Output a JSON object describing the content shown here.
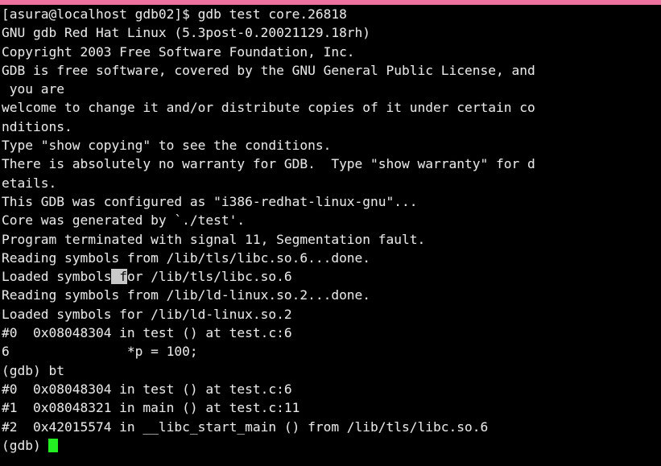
{
  "window": {
    "title_bar_color": "#ec719e",
    "background_color": "#000000",
    "foreground_color": "#e6e6e6",
    "cursor_color": "#22ee22",
    "selection_color": "#c9c9c9"
  },
  "terminal": {
    "prompt_user_host": "[asura@localhost gdb02]$",
    "command": "gdb test core.26818",
    "gdb_prompt": "(gdb)",
    "lines": [
      "[asura@localhost gdb02]$ gdb test core.26818",
      "GNU gdb Red Hat Linux (5.3post-0.20021129.18rh)",
      "Copyright 2003 Free Software Foundation, Inc.",
      "GDB is free software, covered by the GNU General Public License, and",
      " you are",
      "welcome to change it and/or distribute copies of it under certain co",
      "nditions.",
      "Type \"show copying\" to see the conditions.",
      "There is absolutely no warranty for GDB.  Type \"show warranty\" for d",
      "etails.",
      "This GDB was configured as \"i386-redhat-linux-gnu\"...",
      "Core was generated by `./test'.",
      "Program terminated with signal 11, Segmentation fault.",
      "Reading symbols from /lib/tls/libc.so.6...done.",
      "Loaded symbols for /lib/tls/libc.so.6",
      "Reading symbols from /lib/ld-linux.so.2...done.",
      "Loaded symbols for /lib/ld-linux.so.2",
      "#0  0x08048304 in test () at test.c:6",
      "6               *p = 100;",
      "(gdb) bt",
      "#0  0x08048304 in test () at test.c:6",
      "#1  0x08048321 in main () at test.c:11",
      "#2  0x42015574 in __libc_start_main () from /lib/tls/libc.so.6",
      "(gdb) "
    ],
    "highlighted_line_index": 14,
    "highlight": {
      "before": "Loaded symbols",
      "selected": " f",
      "after": "or /lib/tls/libc.so.6"
    },
    "cursor_line_index": 23,
    "cursor_line_text": "(gdb) "
  }
}
